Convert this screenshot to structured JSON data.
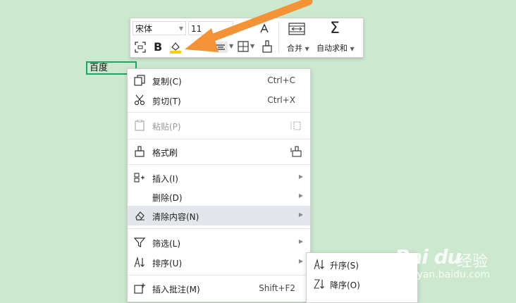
{
  "toolbar": {
    "font_name": "宋体",
    "font_size": "11",
    "bold_label": "B",
    "merge_label": "合并",
    "autosum_label": "自动求和"
  },
  "cell": {
    "value": "百度"
  },
  "context_menu": {
    "copy": {
      "label": "复制(C)",
      "shortcut": "Ctrl+C"
    },
    "cut": {
      "label": "剪切(T)",
      "shortcut": "Ctrl+X"
    },
    "paste": {
      "label": "粘贴(P)"
    },
    "format_painter": {
      "label": "格式刷"
    },
    "insert": {
      "label": "插入(I)"
    },
    "delete": {
      "label": "删除(D)"
    },
    "clear_contents": {
      "label": "清除内容(N)"
    },
    "filter": {
      "label": "筛选(L)"
    },
    "sort": {
      "label": "排序(U)"
    },
    "insert_comment": {
      "label": "插入批注(M)",
      "shortcut": "Shift+F2"
    }
  },
  "sort_submenu": {
    "ascending": "升序(S)",
    "descending": "降序(O)"
  },
  "watermark": {
    "logo": "Bai du",
    "cn": "经验",
    "url": "jingyan.baidu.com"
  },
  "colors": {
    "background": "#cce8cf",
    "cell_border": "#21a366",
    "arrow": "#f39237",
    "highlight": "#e3e6eb"
  }
}
